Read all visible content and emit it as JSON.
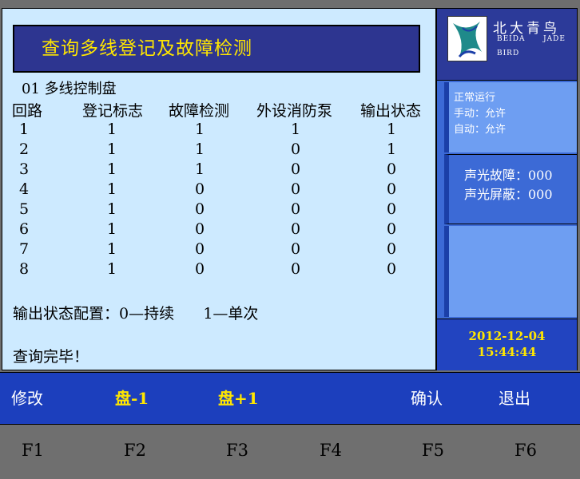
{
  "title": "查询多线登记及故障检测",
  "panel_label": "01  多线控制盘",
  "headers": [
    "回路",
    "登记标志",
    "故障检测",
    "外设消防泵",
    "输出状态"
  ],
  "rows": [
    [
      "1",
      "1",
      "1",
      "1",
      "1"
    ],
    [
      "2",
      "1",
      "1",
      "0",
      "1"
    ],
    [
      "3",
      "1",
      "1",
      "0",
      "0"
    ],
    [
      "4",
      "1",
      "0",
      "0",
      "0"
    ],
    [
      "5",
      "1",
      "0",
      "0",
      "0"
    ],
    [
      "6",
      "1",
      "0",
      "0",
      "0"
    ],
    [
      "7",
      "1",
      "0",
      "0",
      "0"
    ],
    [
      "8",
      "1",
      "0",
      "0",
      "0"
    ]
  ],
  "config_line": "输出状态配置：0—持续      1—单次",
  "status_line": "查询完毕！",
  "logo": {
    "cn": "北大青鸟",
    "en1": "BEIDA",
    "en2": "JADE",
    "en3": "BIRD"
  },
  "status": {
    "line1": "正常运行",
    "line2": "手动：允许",
    "line3": "自动：允许"
  },
  "faults": {
    "sound_light_fault": "声光故障：000",
    "sound_light_mask": "声光屏蔽：000"
  },
  "datetime": {
    "date": "2012-12-04",
    "time": "15:44:44"
  },
  "softkeys": [
    "修改",
    "盘-1",
    "盘+1",
    "",
    "确认",
    "退出"
  ],
  "fkeys": [
    "F1",
    "F2",
    "F3",
    "F4",
    "F5",
    "F6"
  ],
  "colors": {
    "accent_yellow": "#ffe600",
    "panel_bg": "#cdeaff",
    "bar_blue": "#1c3fbd"
  }
}
